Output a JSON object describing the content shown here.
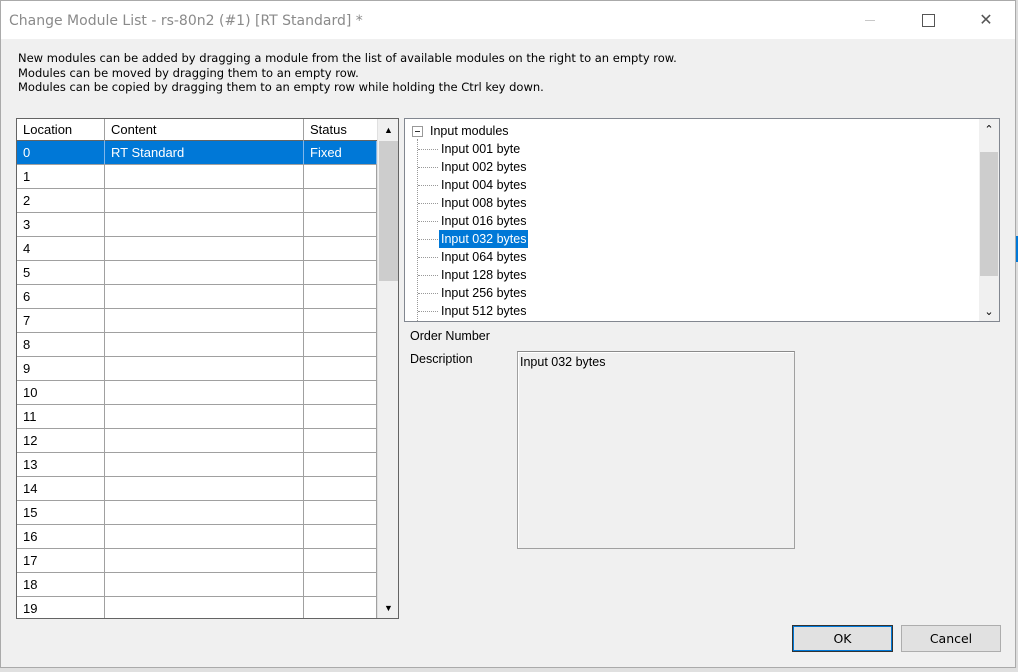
{
  "window": {
    "title": "Change Module List - rs-80n2 (#1) [RT Standard] *",
    "minimize_glyph": "",
    "maximize_glyph": "",
    "close_glyph": "✕"
  },
  "instructions": [
    "New modules can be added by dragging a module from the list of available modules on the right to an empty row.",
    "Modules can be moved by dragging them to an empty row.",
    "Modules can be copied by dragging them to an empty row while holding the Ctrl key down."
  ],
  "module_table": {
    "columns": [
      "Location",
      "Content",
      "Status"
    ],
    "rows": [
      {
        "location": "0",
        "content": "RT Standard",
        "status": "Fixed",
        "selected": true
      },
      {
        "location": "1",
        "content": "",
        "status": ""
      },
      {
        "location": "2",
        "content": "",
        "status": ""
      },
      {
        "location": "3",
        "content": "",
        "status": ""
      },
      {
        "location": "4",
        "content": "",
        "status": ""
      },
      {
        "location": "5",
        "content": "",
        "status": ""
      },
      {
        "location": "6",
        "content": "",
        "status": ""
      },
      {
        "location": "7",
        "content": "",
        "status": ""
      },
      {
        "location": "8",
        "content": "",
        "status": ""
      },
      {
        "location": "9",
        "content": "",
        "status": ""
      },
      {
        "location": "10",
        "content": "",
        "status": ""
      },
      {
        "location": "11",
        "content": "",
        "status": ""
      },
      {
        "location": "12",
        "content": "",
        "status": ""
      },
      {
        "location": "13",
        "content": "",
        "status": ""
      },
      {
        "location": "14",
        "content": "",
        "status": ""
      },
      {
        "location": "15",
        "content": "",
        "status": ""
      },
      {
        "location": "16",
        "content": "",
        "status": ""
      },
      {
        "location": "17",
        "content": "",
        "status": ""
      },
      {
        "location": "18",
        "content": "",
        "status": ""
      },
      {
        "location": "19",
        "content": "",
        "status": ""
      }
    ],
    "scroll_up_glyph": "▲",
    "scroll_down_glyph": "▼"
  },
  "module_tree": {
    "root": "Input modules",
    "items": [
      {
        "label": "Input 001 byte"
      },
      {
        "label": "Input 002 bytes"
      },
      {
        "label": "Input 004 bytes"
      },
      {
        "label": "Input 008 bytes"
      },
      {
        "label": "Input 016 bytes"
      },
      {
        "label": "Input 032 bytes",
        "selected": true
      },
      {
        "label": "Input 064 bytes"
      },
      {
        "label": "Input 128 bytes"
      },
      {
        "label": "Input 256 bytes"
      },
      {
        "label": "Input 512 bytes"
      }
    ],
    "scroll_up_glyph": "⌃",
    "scroll_down_glyph": "⌄"
  },
  "details": {
    "order_number_label": "Order Number",
    "description_label": "Description",
    "description_value": "Input 032 bytes"
  },
  "buttons": {
    "ok": "OK",
    "cancel": "Cancel"
  },
  "colors": {
    "selection": "#0078d7"
  }
}
